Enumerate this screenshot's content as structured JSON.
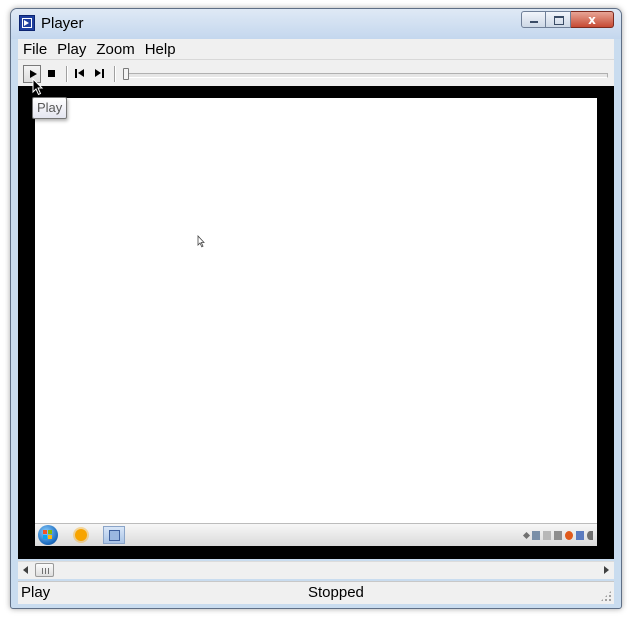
{
  "window": {
    "title": "Player",
    "controls": [
      "minimize",
      "maximize",
      "close"
    ],
    "close_glyph": "x"
  },
  "menu": {
    "items": [
      {
        "label": "File"
      },
      {
        "label": "Play"
      },
      {
        "label": "Zoom"
      },
      {
        "label": "Help"
      }
    ]
  },
  "toolbar": {
    "buttons": [
      {
        "name": "play",
        "icon": "play-icon",
        "pressed": true
      },
      {
        "name": "stop",
        "icon": "stop-icon"
      },
      {
        "name": "previous",
        "icon": "skip-back-icon"
      },
      {
        "name": "next",
        "icon": "skip-forward-icon"
      }
    ],
    "seek_position": 0
  },
  "tooltip": {
    "text": "Play"
  },
  "video": {
    "background": "#000000",
    "screen_background": "#ffffff",
    "taskbar": {
      "items": [
        "start-orb-icon",
        "sun-app-icon",
        "picture-app-icon"
      ],
      "tray_icons": [
        "tray-expand-icon",
        "tray-network-icon",
        "tray-sound-icon",
        "tray-power-icon",
        "tray-firefox-icon",
        "tray-shield-icon",
        "tray-moon-icon"
      ]
    }
  },
  "scrollbar": {
    "position": 0
  },
  "status": {
    "left": "Play",
    "center": "Stopped"
  }
}
